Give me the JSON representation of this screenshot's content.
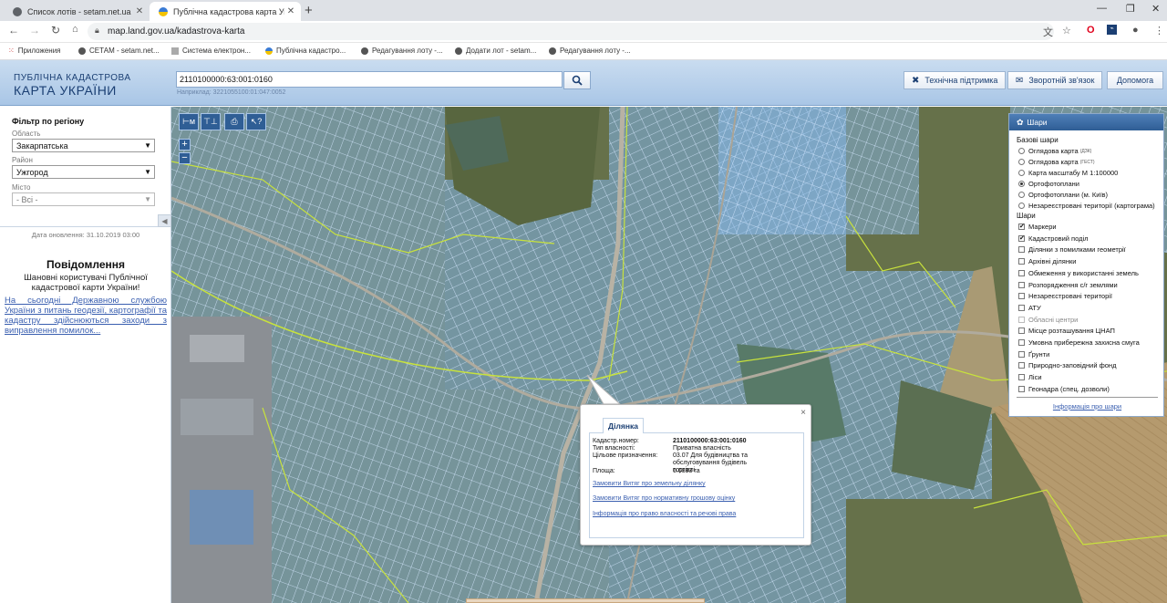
{
  "browser": {
    "tabs": [
      {
        "title": "Список лотів - setam.net.ua",
        "active": false
      },
      {
        "title": "Публічна кадастрова карта Укр",
        "active": true
      }
    ],
    "new_tab": "+",
    "url": "map.land.gov.ua/kadastrova-karta",
    "bookmarks": [
      "Приложения",
      "СЕТАМ - setam.net...",
      "Система електрон...",
      "Публічна кадастро...",
      "Редагування лоту -...",
      "Додати лот - setam...",
      "Редагування лоту -..."
    ]
  },
  "header": {
    "logo_line1": "ПУБЛІЧНА КАДАСТРОВА",
    "logo_line2": "КАРТА УКРАЇНИ",
    "search_value": "2110100000:63:001:0160",
    "search_example": "Наприклад: 3221055100:01:047:0052",
    "buttons": {
      "support": "Технічна підтримка",
      "feedback": "Зворотній зв'язок",
      "help": "Допомога"
    }
  },
  "filter": {
    "title": "Фільтр по регіону",
    "region_label": "Область",
    "region_value": "Закарпатська",
    "district_label": "Район",
    "district_value": "Ужгород",
    "city_label": "Місто",
    "city_value": "- Всі -",
    "updated": "Дата оновлення: 31.10.2019 03:00",
    "notice_title": "Повідомлення",
    "notice_body": "Шановні користувачі Публічної кадастрової карти України!",
    "notice_link": "На сьогодні Державною службою України з питань геодезії, картографії та кадастру здійснюються заходи з виправлення помилок..."
  },
  "map_tools": {
    "ruler": "⊢м",
    "measure": "⊤⊥",
    "print": "⎙",
    "identify": "↖?",
    "zoom_in": "+",
    "zoom_out": "−"
  },
  "layers": {
    "title": "Шари",
    "base_title": "Базові шари",
    "base_layers": [
      {
        "label": "Оглядова карта",
        "sup": "(ДЗК)",
        "selected": false
      },
      {
        "label": "Оглядова карта",
        "sup": "(ГЕСТ)",
        "selected": false
      },
      {
        "label": "Карта масштабу М 1:100000",
        "sup": "",
        "selected": false
      },
      {
        "label": "Ортофотоплани",
        "sup": "",
        "selected": true
      },
      {
        "label": "Ортофотоплани (м. Київ)",
        "sup": "",
        "selected": false
      },
      {
        "label": "Незареєстровані території (картограма)",
        "sup": "",
        "selected": false
      }
    ],
    "overlay_title": "Шари",
    "overlays": [
      {
        "label": "Маркери",
        "checked": true,
        "dim": false
      },
      {
        "label": "Кадастровий поділ",
        "checked": true,
        "dim": false
      },
      {
        "label": "Ділянки з помилками геометрії",
        "checked": false,
        "dim": false
      },
      {
        "label": "Архівні ділянки",
        "checked": false,
        "dim": false
      },
      {
        "label": "Обмеження у використанні земель",
        "checked": false,
        "dim": false
      },
      {
        "label": "Розпорядження с/г землями",
        "checked": false,
        "dim": false
      },
      {
        "label": "Незареєстровані території",
        "checked": false,
        "dim": false
      },
      {
        "label": "АТУ",
        "checked": false,
        "dim": false
      },
      {
        "label": "Обласні центри",
        "checked": false,
        "dim": true
      },
      {
        "label": "Місце розташування ЦНАП",
        "checked": false,
        "dim": false
      },
      {
        "label": "Умовна прибережна захисна смуга",
        "checked": false,
        "dim": false
      },
      {
        "label": "Ґрунти",
        "checked": false,
        "dim": false
      },
      {
        "label": "Природно-заповідний фонд",
        "checked": false,
        "dim": false
      },
      {
        "label": "Ліси",
        "checked": false,
        "dim": false
      },
      {
        "label": "Геонадра (спец. дозволи)",
        "checked": false,
        "dim": false
      }
    ],
    "info_link": "Інформація про шари"
  },
  "popup": {
    "tab": "Ділянка",
    "close": "×",
    "fields": [
      {
        "k": "Кадастр.номер:",
        "v": "2110100000:63:001:0160"
      },
      {
        "k": "Тип власності:",
        "v": "Приватна власність"
      },
      {
        "k": "Цільове призначення:",
        "v": "03.07 Для будівництва та обслуговування будівель торгівлі"
      },
      {
        "k": "Площа:",
        "v": "0.0393 га"
      }
    ],
    "links": [
      "Замовити Витяг про земельну ділянку",
      "Замовити Витяг про нормативну грошову оцінку",
      "Інформація про право власності та речові права"
    ]
  },
  "colors": {
    "header_bg": "#b8d1ec",
    "brand_dark": "#1b3f73",
    "parcel_fill": "#7fb2e8",
    "parcel_stroke": "#cfe4ff",
    "boundary": "#c8e23c"
  }
}
